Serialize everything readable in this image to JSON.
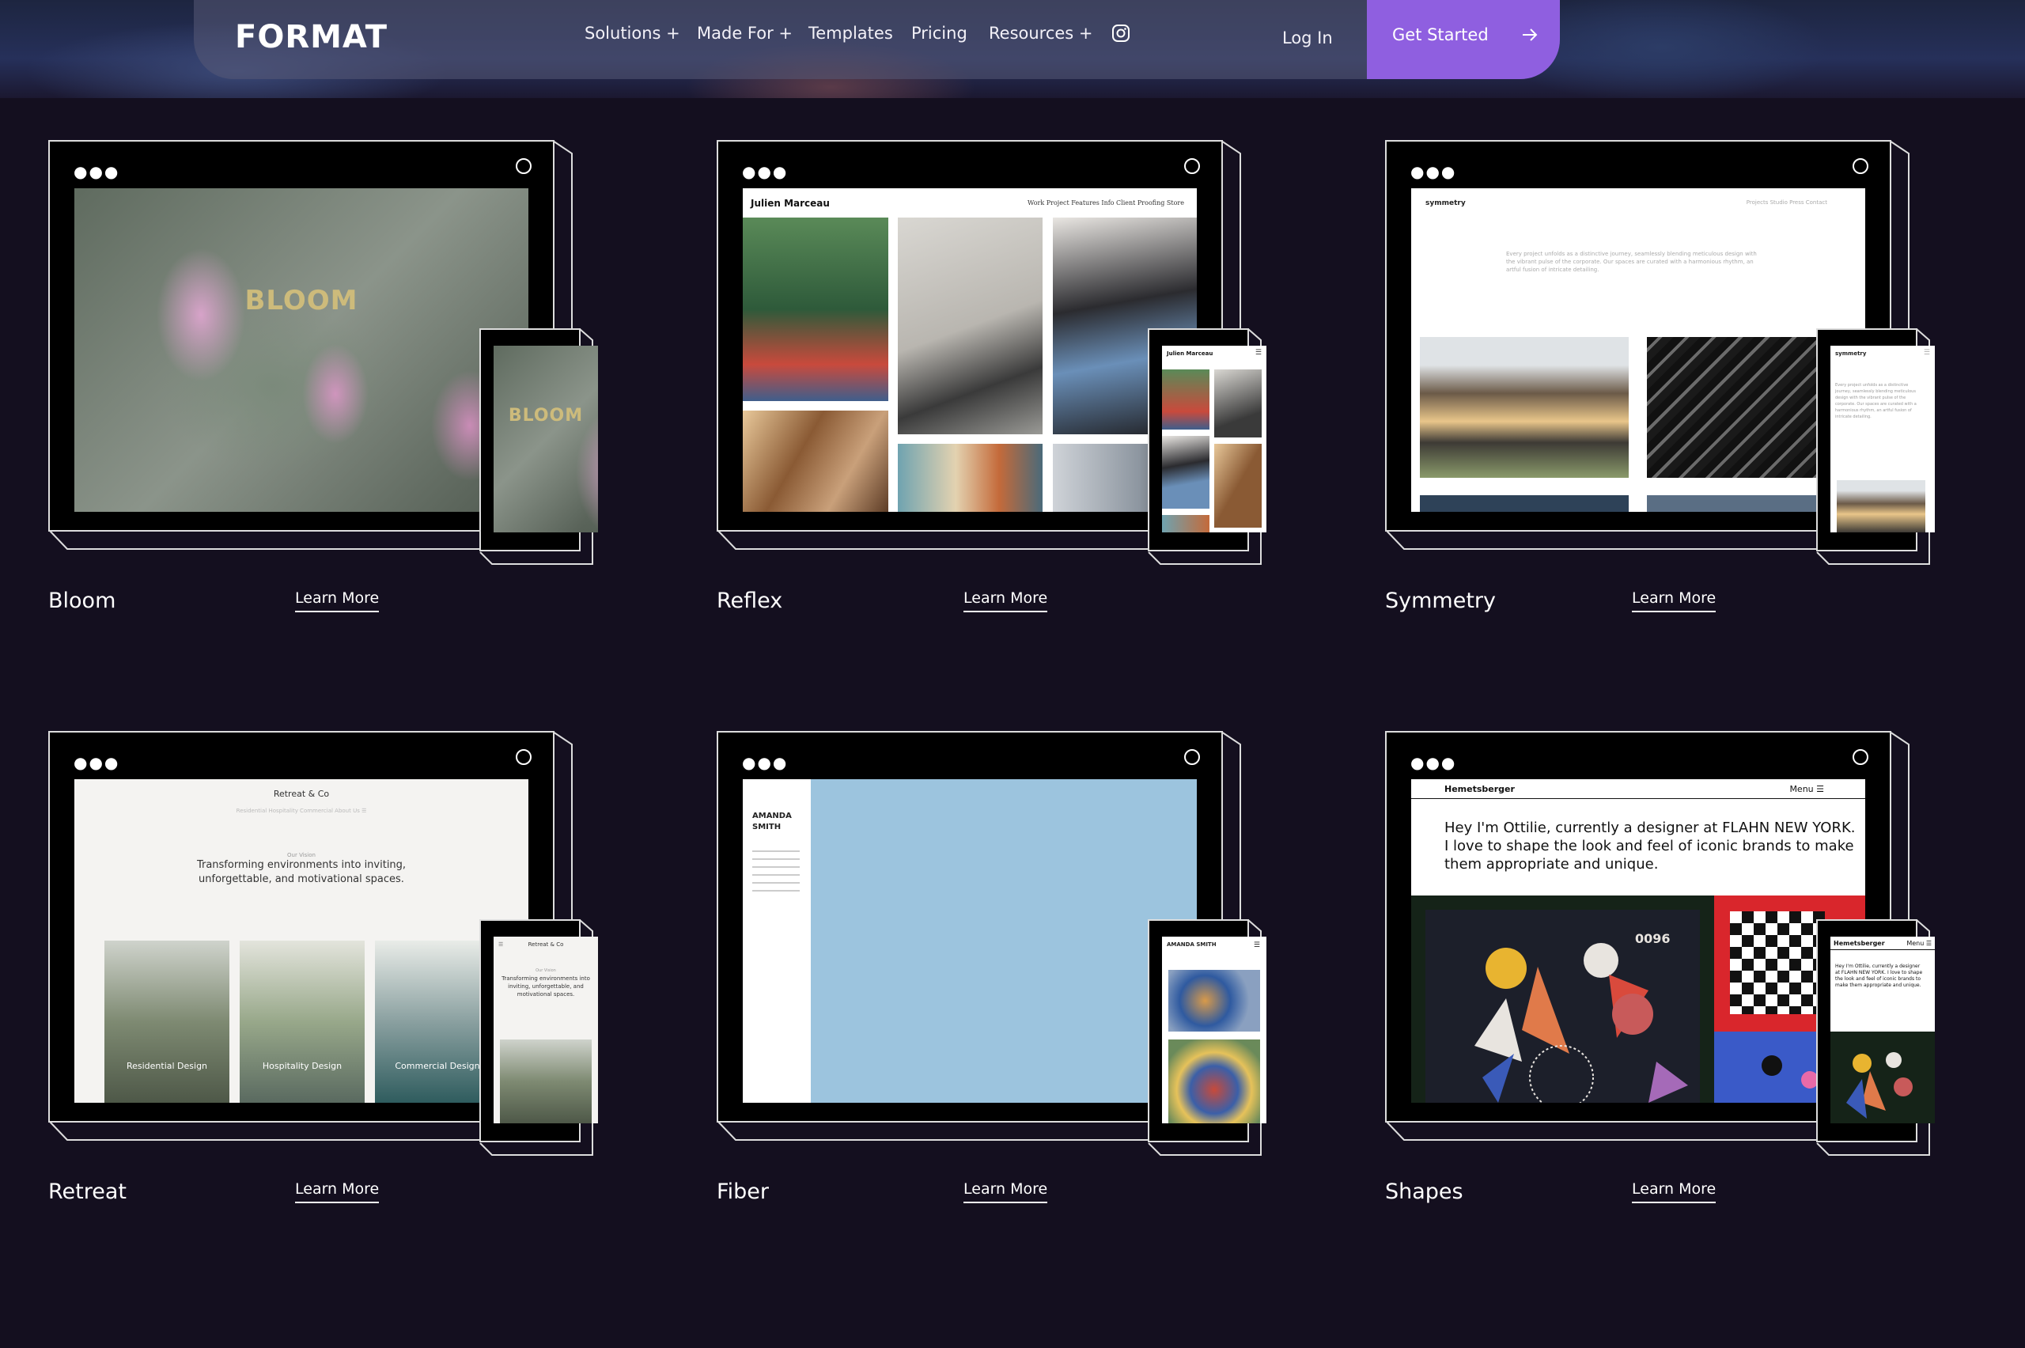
{
  "nav": {
    "logo": "FORMAT",
    "links": [
      "Solutions +",
      "Made For +",
      "Templates",
      "Pricing",
      "Resources +"
    ],
    "login": "Log In",
    "cta": "Get Started"
  },
  "learn_more": "Learn More",
  "templates": [
    {
      "name": "Bloom",
      "screen_word": "BLOOM"
    },
    {
      "name": "Reflex",
      "site_name": "Julien Marceau",
      "site_menu": "Work   Project   Features   Info   Client Proofing   Store"
    },
    {
      "name": "Symmetry",
      "site_name": "symmetry",
      "site_menu": "Projects   Studio   Press   Contact",
      "site_intro": "Every project unfolds as a distinctive journey, seamlessly blending meticulous design with the vibrant pulse of the corporate. Our spaces are curated with a harmonious rhythm, an artful fusion of intricate detailing."
    },
    {
      "name": "Retreat",
      "site_name": "Retreat & Co",
      "site_menu": "Residential   Hospitality   Commercial   About Us   ☰",
      "site_eyebrow": "Our Vision",
      "site_headline": "Transforming environments into inviting, unforgettable, and motivational spaces.",
      "categories": [
        "Residential Design",
        "Hospitality Design",
        "Commercial Design"
      ]
    },
    {
      "name": "Fiber",
      "site_name": "AMANDA SMITH"
    },
    {
      "name": "Shapes",
      "site_name": "Hemetsberger",
      "site_menu": "Menu ☰",
      "site_bio": "Hey I'm Ottilie, currently a designer at FLAHN NEW YORK. I love to shape the look and feel of iconic brands to make them appropriate and unique.",
      "artwork_number": "0096"
    }
  ],
  "colors": {
    "background": "#140f1f",
    "accent": "#8f5fe0"
  }
}
